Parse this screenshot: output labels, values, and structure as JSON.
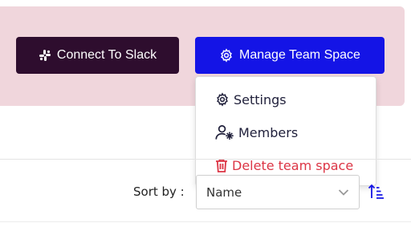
{
  "header": {
    "connect_slack_label": "Connect To Slack",
    "manage_team_label": "Manage Team Space"
  },
  "menu": {
    "items": [
      {
        "label": "Settings",
        "icon": "gear-icon"
      },
      {
        "label": "Members",
        "icon": "user-gear-icon"
      },
      {
        "label": "Delete team space",
        "icon": "trash-icon"
      }
    ]
  },
  "sort": {
    "label": "Sort by :",
    "selected": "Name"
  },
  "colors": {
    "banner": "#f0d6dc",
    "slack_button": "#2e0d2e",
    "primary": "#1414e6",
    "danger": "#dc3545"
  }
}
